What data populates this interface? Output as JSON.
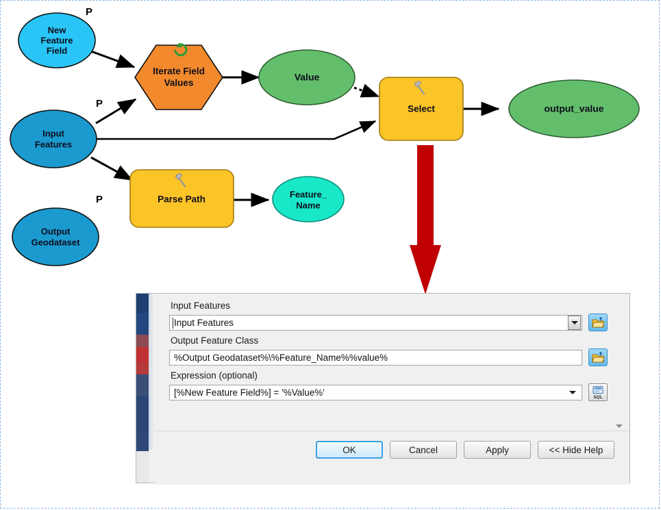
{
  "model": {
    "title": "ArcGIS ModelBuilder iteration model",
    "nodes": [
      {
        "id": "new_feature_field",
        "label_lines": [
          "New",
          "Feature",
          "Field"
        ],
        "shape": "ellipse",
        "kind": "variable",
        "color": "#29c5f6",
        "param_marker": "P"
      },
      {
        "id": "input_features",
        "label_lines": [
          "Input",
          "Features"
        ],
        "shape": "ellipse",
        "kind": "variable",
        "color": "#1b9ad0",
        "param_marker": "P"
      },
      {
        "id": "output_geodataset",
        "label_lines": [
          "Output",
          "Geodataset"
        ],
        "shape": "ellipse",
        "kind": "variable",
        "color": "#1b9ad0",
        "param_marker": "P"
      },
      {
        "id": "iterate_field_values",
        "label_lines": [
          "Iterate Field",
          "Values"
        ],
        "shape": "hexagon",
        "kind": "iterator",
        "color": "#f2892c",
        "icon": "loop-icon"
      },
      {
        "id": "value",
        "label_lines": [
          "Value"
        ],
        "shape": "ellipse",
        "kind": "derived",
        "color": "#63be6b"
      },
      {
        "id": "select",
        "label_lines": [
          "Select"
        ],
        "shape": "rounded-rect",
        "kind": "tool",
        "color": "#fbc427",
        "icon": "hammer-icon"
      },
      {
        "id": "output_value",
        "label_lines": [
          "output_value"
        ],
        "shape": "ellipse",
        "kind": "derived",
        "color": "#63be6b"
      },
      {
        "id": "parse_path",
        "label_lines": [
          "Parse Path"
        ],
        "shape": "rounded-rect",
        "kind": "tool",
        "color": "#fbc427",
        "icon": "hammer-icon"
      },
      {
        "id": "feature_name",
        "label_lines": [
          "Feature_",
          "Name"
        ],
        "shape": "ellipse",
        "kind": "derived",
        "color": "#18e8c8"
      }
    ],
    "connectors": [
      {
        "from": "new_feature_field",
        "to": "iterate_field_values",
        "style": "solid"
      },
      {
        "from": "input_features",
        "to": "iterate_field_values",
        "style": "solid"
      },
      {
        "from": "input_features",
        "to": "select",
        "style": "solid"
      },
      {
        "from": "input_features",
        "to": "parse_path",
        "style": "solid"
      },
      {
        "from": "iterate_field_values",
        "to": "value",
        "style": "solid"
      },
      {
        "from": "value",
        "to": "select",
        "style": "dotted"
      },
      {
        "from": "select",
        "to": "output_value",
        "style": "solid"
      },
      {
        "from": "parse_path",
        "to": "feature_name",
        "style": "solid"
      }
    ],
    "callout_arrow": {
      "name": "red-down-arrow",
      "color": "#c00000",
      "from": "select",
      "to": "tool-dialog"
    }
  },
  "dialog": {
    "fields": [
      {
        "id": "input_features",
        "label": "Input Features",
        "value": "Input Features",
        "control": "combobox-raised",
        "side_button": "browse-folder-icon"
      },
      {
        "id": "output_feature_class",
        "label": "Output Feature Class",
        "value": "%Output Geodataset%\\%Feature_Name%%value%",
        "control": "textbox",
        "side_button": "browse-folder-icon"
      },
      {
        "id": "expression",
        "label": "Expression (optional)",
        "value": "[%New Feature Field%] = '%Value%'",
        "control": "combobox-flat",
        "side_button": "sql-query-builder-icon"
      }
    ],
    "buttons": [
      {
        "id": "ok",
        "label": "OK",
        "primary": true
      },
      {
        "id": "cancel",
        "label": "Cancel",
        "primary": false
      },
      {
        "id": "apply",
        "label": "Apply",
        "primary": false
      },
      {
        "id": "hide_help",
        "label": "<< Hide Help",
        "primary": false
      }
    ]
  },
  "colors": {
    "variable_light_blue": "#29c5f6",
    "variable_blue": "#1b9ad0",
    "iterator_orange": "#f2892c",
    "tool_yellow": "#fbc427",
    "derived_green": "#63be6b",
    "derived_turquoise": "#18e8c8",
    "callout_red": "#c00000",
    "dialog_background": "#f0f0f0",
    "selection_border": "#8fb4d9"
  }
}
